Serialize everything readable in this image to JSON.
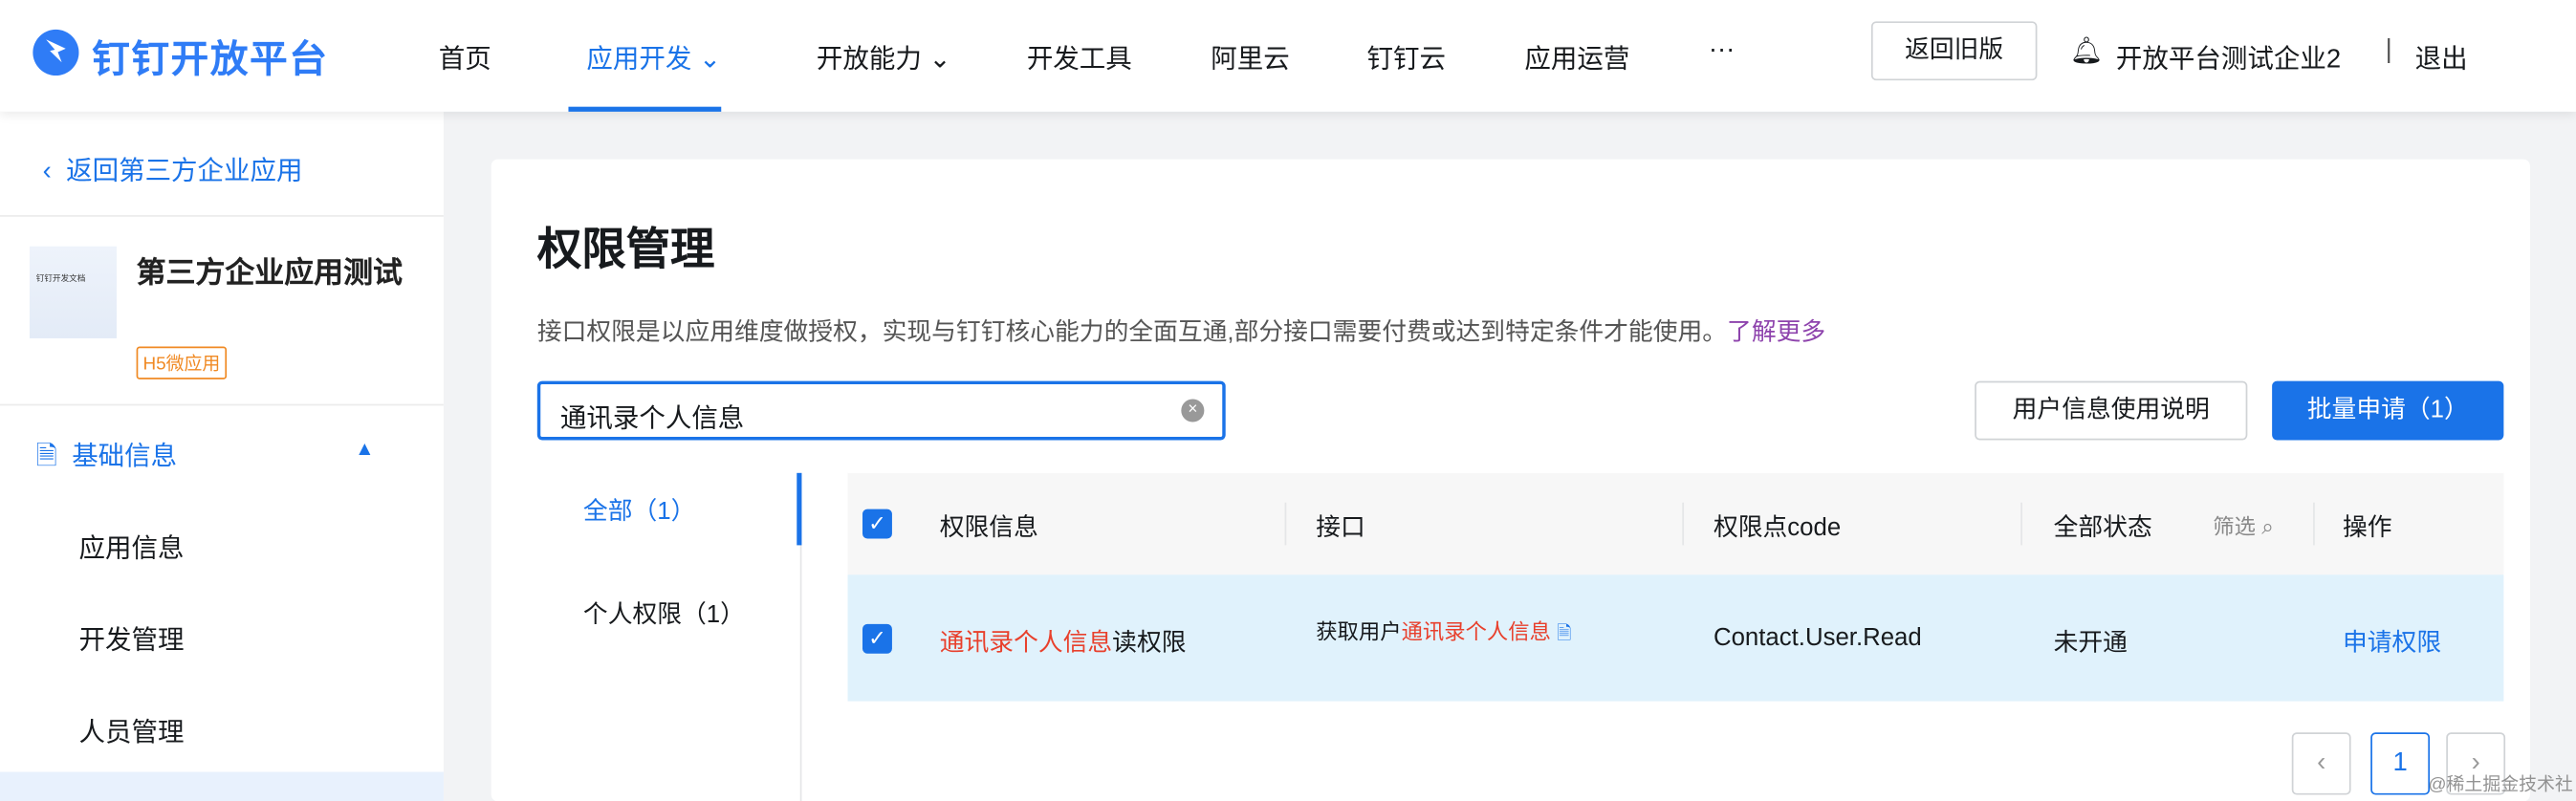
{
  "header": {
    "logo": "钉钉开放平台",
    "nav": [
      "首页",
      "应用开发",
      "开放能力",
      "开发工具",
      "阿里云",
      "钉钉云",
      "应用运营",
      "···"
    ],
    "active_nav": "应用开发",
    "old_version": "返回旧版",
    "org": "开放平台测试企业2",
    "divider": "|",
    "logout": "退出"
  },
  "sidebar": {
    "back": "返回第三方企业应用",
    "app_name": "第三方企业应用测试",
    "app_badge": "H5微应用",
    "thumb_title": "钉钉开发文档",
    "section": "基础信息",
    "items": [
      "应用信息",
      "开发管理",
      "人员管理"
    ]
  },
  "main": {
    "title": "权限管理",
    "desc": "接口权限是以应用维度做授权，实现与钉钉核心能力的全面互通,部分接口需要付费或达到特定条件才能使用。",
    "learn_more": "了解更多",
    "search_value": "通讯录个人信息",
    "user_info_btn": "用户信息使用说明",
    "batch_btn": "批量申请（1）",
    "tabs": [
      {
        "label": "全部（1）",
        "active": true
      },
      {
        "label": "个人权限（1）",
        "active": false
      }
    ],
    "table": {
      "headers": [
        "权限信息",
        "接口",
        "权限点code",
        "全部状态",
        "操作"
      ],
      "filter": "筛选",
      "rows": [
        {
          "checked": true,
          "perm_highlight": "通讯录个人信息",
          "perm_rest": "读权限",
          "api_prefix": "获取用户",
          "api_highlight": "通讯录个人信息",
          "code": "Contact.User.Read",
          "status": "未开通",
          "action": "申请权限"
        }
      ]
    },
    "pagination": {
      "current": "1"
    }
  },
  "watermark": "@稀土掘金技术社区"
}
